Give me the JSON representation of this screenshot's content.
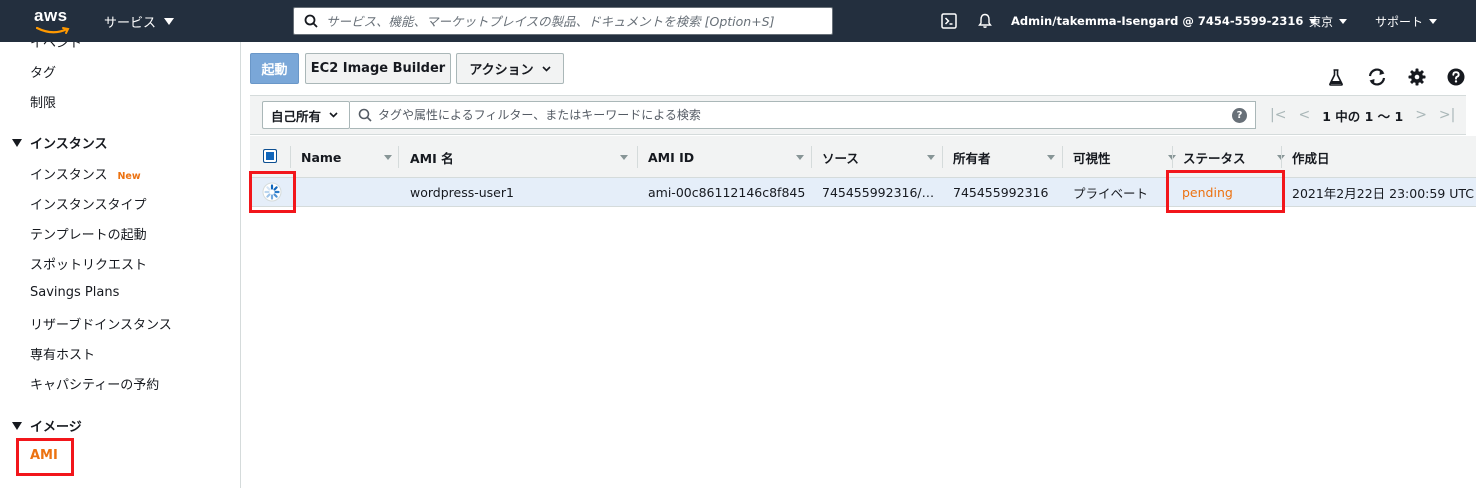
{
  "topnav": {
    "logo_text": "aws",
    "services_label": "サービス",
    "search_placeholder": "サービス、機能、マーケットプレイスの製品、ドキュメントを検索 [Option+S]",
    "account_label": "Admin/takemma-Isengard @ 7454-5599-2316",
    "region_label": "東京",
    "support_label": "サポート"
  },
  "sidebar": {
    "items": [
      {
        "label": "イベント"
      },
      {
        "label": "タグ"
      },
      {
        "label": "制限"
      }
    ],
    "instances_section": {
      "title": "インスタンス",
      "items": [
        {
          "label": "インスタンス",
          "badge": "New"
        },
        {
          "label": "インスタンスタイプ"
        },
        {
          "label": "テンプレートの起動"
        },
        {
          "label": "スポットリクエスト"
        },
        {
          "label": "Savings Plans"
        },
        {
          "label": "リザーブドインスタンス"
        },
        {
          "label": "専有ホスト"
        },
        {
          "label": "キャパシティーの予約"
        }
      ]
    },
    "images_section": {
      "title": "イメージ",
      "items": [
        {
          "label": "AMI",
          "active": true
        }
      ]
    }
  },
  "toolbar": {
    "launch_label": "起動",
    "image_builder_label": "EC2 Image Builder",
    "actions_label": "アクション"
  },
  "filter": {
    "owner_label": "自己所有",
    "placeholder": "タグや属性によるフィルター、またはキーワードによる検索",
    "pagination": "1 中の 1 ～ 1"
  },
  "table": {
    "columns": [
      "Name",
      "AMI 名",
      "AMI ID",
      "ソース",
      "所有者",
      "可視性",
      "ステータス",
      "作成日"
    ],
    "rows": [
      {
        "name": "",
        "ami_name": "wordpress-user1",
        "ami_id": "ami-00c86112146c8f845",
        "source": "745455992316/…",
        "owner": "745455992316",
        "visibility": "プライベート",
        "status": "pending",
        "created": "2021年2月22日 23:00:59 UTC"
      }
    ]
  },
  "colors": {
    "nav_bg": "#232f3e",
    "accent_orange": "#ec7211",
    "highlight_red": "#f2161b",
    "selected_row": "#e5eef9",
    "primary_button": "#7aa7d8"
  }
}
